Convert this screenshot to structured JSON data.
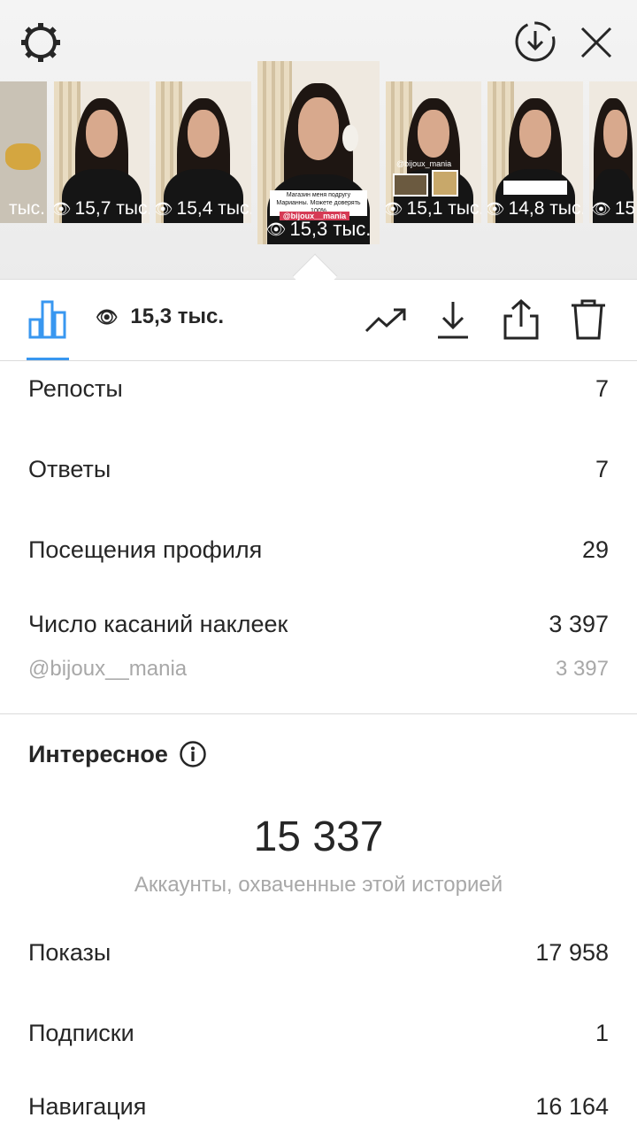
{
  "carousel": [
    {
      "views": "тыс."
    },
    {
      "views": "15,7 тыс."
    },
    {
      "views": "15,4 тыс."
    },
    {
      "views": "15,3 тыс.",
      "caption": "Магазин меня подругу Марианны. Можете доверять 100%",
      "sticker": "@bijoux__mania"
    },
    {
      "views": "15,1 тыс.",
      "sticker": "@bijoux_mania"
    },
    {
      "views": "14,8 тыс."
    },
    {
      "views": "15"
    }
  ],
  "toolbar": {
    "views": "15,3 тыс."
  },
  "metrics": [
    {
      "label": "Репосты",
      "value": "7"
    },
    {
      "label": "Ответы",
      "value": "7"
    },
    {
      "label": "Посещения профиля",
      "value": "29"
    },
    {
      "label": "Число касаний наклеек",
      "value": "3 397"
    },
    {
      "label": "@bijoux__mania",
      "value": "3 397"
    }
  ],
  "discovery": {
    "title": "Интересное",
    "reach_value": "15 337",
    "reach_caption": "Аккаунты, охваченные этой историей",
    "rows": [
      {
        "label": "Показы",
        "value": "17 958"
      },
      {
        "label": "Подписки",
        "value": "1"
      },
      {
        "label": "Навигация",
        "value": "16 164"
      }
    ]
  },
  "colors": {
    "accent": "#3897f0",
    "text": "#262626",
    "secondary_text": "#a8a8a8",
    "divider": "#dbdbdb"
  },
  "icons": [
    "settings-icon",
    "download-circle-icon",
    "close-icon",
    "bar-chart-icon",
    "eye-icon",
    "trend-icon",
    "download-icon",
    "share-icon",
    "trash-icon",
    "info-icon"
  ]
}
